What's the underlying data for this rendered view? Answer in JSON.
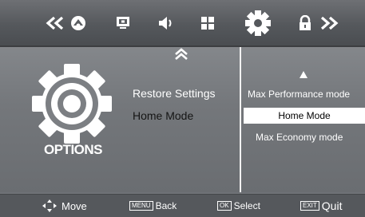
{
  "topbar": {
    "icons": [
      "double-chevron-left-icon",
      "picture-icon",
      "screen-icon",
      "speaker-icon",
      "grid-icon",
      "gear-icon",
      "lock-icon",
      "double-chevron-right-icon"
    ]
  },
  "options_panel": {
    "title": "OPTIONS",
    "menu": [
      {
        "label": "Restore Settings",
        "color": "#ffffff"
      },
      {
        "label": "Home Mode",
        "color": "#151515"
      }
    ]
  },
  "submenu": {
    "items": [
      {
        "label": "Max Performance mode",
        "selected": false
      },
      {
        "label": "Home Mode",
        "selected": true
      },
      {
        "label": "Max Economy mode",
        "selected": false
      }
    ]
  },
  "bottombar": {
    "move": "Move",
    "menu_key": "MENU",
    "back": "Back",
    "ok_key": "OK",
    "select": "Select",
    "exit_key": "EXIT",
    "quit": "Quit"
  }
}
